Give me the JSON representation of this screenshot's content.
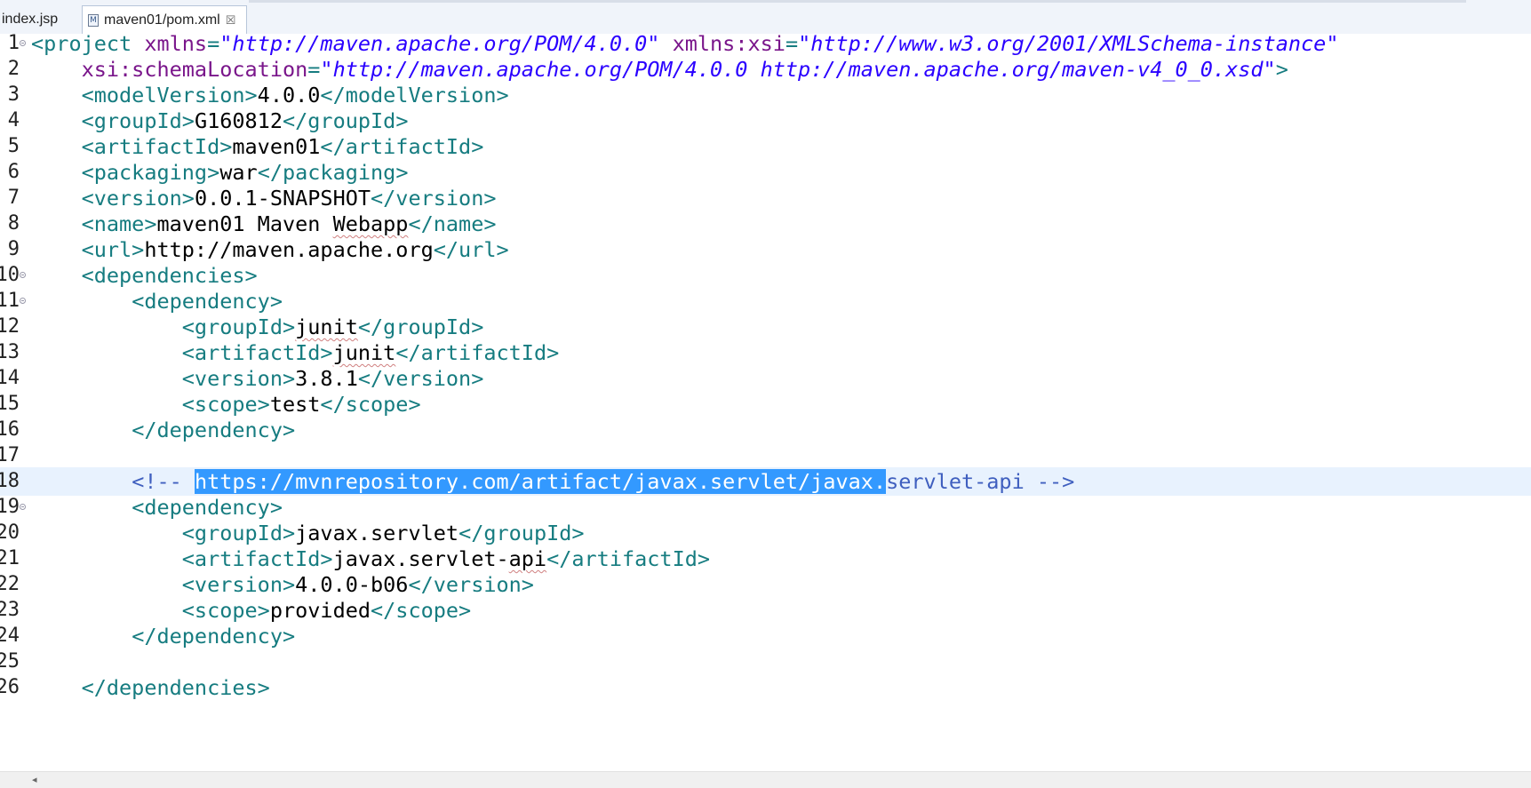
{
  "tabs": [
    {
      "label": "index.jsp",
      "active": false
    },
    {
      "label": "maven01/pom.xml",
      "active": true,
      "icon": "M",
      "close": "☒"
    }
  ],
  "editor": {
    "current_line": 18,
    "lines": [
      {
        "n": "1",
        "fold": true,
        "tokens": [
          {
            "t": "tg",
            "v": "<project "
          },
          {
            "t": "an",
            "v": "xmlns"
          },
          {
            "t": "tg",
            "v": "="
          },
          {
            "t": "av",
            "v": "\"http://maven.apache.org/POM/4.0.0\""
          },
          {
            "t": "tx",
            "v": " "
          },
          {
            "t": "an",
            "v": "xmlns:xsi"
          },
          {
            "t": "tg",
            "v": "="
          },
          {
            "t": "av",
            "v": "\"http://www.w3.org/2001/XMLSchema-instance\""
          }
        ]
      },
      {
        "n": "2",
        "tokens": [
          {
            "t": "tx",
            "v": "    "
          },
          {
            "t": "an",
            "v": "xsi:schemaLocation"
          },
          {
            "t": "tg",
            "v": "="
          },
          {
            "t": "av",
            "v": "\"http://maven.apache.org/POM/4.0.0 http://maven.apache.org/maven-v4_0_0.xsd\""
          },
          {
            "t": "tg",
            "v": ">"
          }
        ]
      },
      {
        "n": "3",
        "tokens": [
          {
            "t": "tx",
            "v": "    "
          },
          {
            "t": "tg",
            "v": "<modelVersion>"
          },
          {
            "t": "tx",
            "v": "4.0.0"
          },
          {
            "t": "tg",
            "v": "</modelVersion>"
          }
        ]
      },
      {
        "n": "4",
        "tokens": [
          {
            "t": "tx",
            "v": "    "
          },
          {
            "t": "tg",
            "v": "<groupId>"
          },
          {
            "t": "tx",
            "v": "G160812"
          },
          {
            "t": "tg",
            "v": "</groupId>"
          }
        ]
      },
      {
        "n": "5",
        "tokens": [
          {
            "t": "tx",
            "v": "    "
          },
          {
            "t": "tg",
            "v": "<artifactId>"
          },
          {
            "t": "tx",
            "v": "maven01"
          },
          {
            "t": "tg",
            "v": "</artifactId>"
          }
        ]
      },
      {
        "n": "6",
        "tokens": [
          {
            "t": "tx",
            "v": "    "
          },
          {
            "t": "tg",
            "v": "<packaging>"
          },
          {
            "t": "tx",
            "v": "war"
          },
          {
            "t": "tg",
            "v": "</packaging>"
          }
        ]
      },
      {
        "n": "7",
        "tokens": [
          {
            "t": "tx",
            "v": "    "
          },
          {
            "t": "tg",
            "v": "<version>"
          },
          {
            "t": "tx",
            "v": "0.0.1-SNAPSHOT"
          },
          {
            "t": "tg",
            "v": "</version>"
          }
        ]
      },
      {
        "n": "8",
        "tokens": [
          {
            "t": "tx",
            "v": "    "
          },
          {
            "t": "tg",
            "v": "<name>"
          },
          {
            "t": "tx",
            "v": "maven01 Maven "
          },
          {
            "t": "tx sq",
            "v": "Webapp"
          },
          {
            "t": "tg",
            "v": "</name>"
          }
        ]
      },
      {
        "n": "9",
        "tokens": [
          {
            "t": "tx",
            "v": "    "
          },
          {
            "t": "tg",
            "v": "<url>"
          },
          {
            "t": "tx",
            "v": "http://maven.apache.org"
          },
          {
            "t": "tg",
            "v": "</url>"
          }
        ]
      },
      {
        "n": "10",
        "fold": true,
        "tokens": [
          {
            "t": "tx",
            "v": "    "
          },
          {
            "t": "tg",
            "v": "<dependencies>"
          }
        ]
      },
      {
        "n": "11",
        "fold": true,
        "tokens": [
          {
            "t": "tx",
            "v": "        "
          },
          {
            "t": "tg",
            "v": "<dependency>"
          }
        ]
      },
      {
        "n": "12",
        "tokens": [
          {
            "t": "tx",
            "v": "            "
          },
          {
            "t": "tg",
            "v": "<groupId>"
          },
          {
            "t": "tx sq",
            "v": "junit"
          },
          {
            "t": "tg",
            "v": "</groupId>"
          }
        ]
      },
      {
        "n": "13",
        "tokens": [
          {
            "t": "tx",
            "v": "            "
          },
          {
            "t": "tg",
            "v": "<artifactId>"
          },
          {
            "t": "tx sq",
            "v": "junit"
          },
          {
            "t": "tg",
            "v": "</artifactId>"
          }
        ]
      },
      {
        "n": "14",
        "tokens": [
          {
            "t": "tx",
            "v": "            "
          },
          {
            "t": "tg",
            "v": "<version>"
          },
          {
            "t": "tx",
            "v": "3.8.1"
          },
          {
            "t": "tg",
            "v": "</version>"
          }
        ]
      },
      {
        "n": "15",
        "tokens": [
          {
            "t": "tx",
            "v": "            "
          },
          {
            "t": "tg",
            "v": "<scope>"
          },
          {
            "t": "tx",
            "v": "test"
          },
          {
            "t": "tg",
            "v": "</scope>"
          }
        ]
      },
      {
        "n": "16",
        "tokens": [
          {
            "t": "tx",
            "v": "        "
          },
          {
            "t": "tg",
            "v": "</dependency>"
          }
        ]
      },
      {
        "n": "17",
        "tokens": []
      },
      {
        "n": "18",
        "tokens": [
          {
            "t": "tx",
            "v": "        "
          },
          {
            "t": "cm",
            "v": "<!-- "
          },
          {
            "t": "sel",
            "v": "https://mvnrepository.com/artifact/javax.servlet/javax."
          },
          {
            "t": "cm",
            "v": "servlet-api -->"
          }
        ]
      },
      {
        "n": "19",
        "fold": true,
        "tokens": [
          {
            "t": "tx",
            "v": "        "
          },
          {
            "t": "tg",
            "v": "<dependency>"
          }
        ]
      },
      {
        "n": "20",
        "tokens": [
          {
            "t": "tx",
            "v": "            "
          },
          {
            "t": "tg",
            "v": "<groupId>"
          },
          {
            "t": "tx",
            "v": "javax.servlet"
          },
          {
            "t": "tg",
            "v": "</groupId>"
          }
        ]
      },
      {
        "n": "21",
        "tokens": [
          {
            "t": "tx",
            "v": "            "
          },
          {
            "t": "tg",
            "v": "<artifactId>"
          },
          {
            "t": "tx",
            "v": "javax.servlet-"
          },
          {
            "t": "tx sq",
            "v": "api"
          },
          {
            "t": "tg",
            "v": "</artifactId>"
          }
        ]
      },
      {
        "n": "22",
        "tokens": [
          {
            "t": "tx",
            "v": "            "
          },
          {
            "t": "tg",
            "v": "<version>"
          },
          {
            "t": "tx",
            "v": "4.0.0-b06"
          },
          {
            "t": "tg",
            "v": "</version>"
          }
        ]
      },
      {
        "n": "23",
        "tokens": [
          {
            "t": "tx",
            "v": "            "
          },
          {
            "t": "tg",
            "v": "<scope>"
          },
          {
            "t": "tx",
            "v": "provided"
          },
          {
            "t": "tg",
            "v": "</scope>"
          }
        ]
      },
      {
        "n": "24",
        "tokens": [
          {
            "t": "tx",
            "v": "        "
          },
          {
            "t": "tg",
            "v": "</dependency>"
          }
        ]
      },
      {
        "n": "25",
        "tokens": []
      },
      {
        "n": "26",
        "tokens": [
          {
            "t": "tx",
            "v": "    "
          },
          {
            "t": "tg",
            "v": "</dependencies>"
          }
        ]
      }
    ]
  },
  "scrollbar": {
    "left_arrow": "◂"
  }
}
